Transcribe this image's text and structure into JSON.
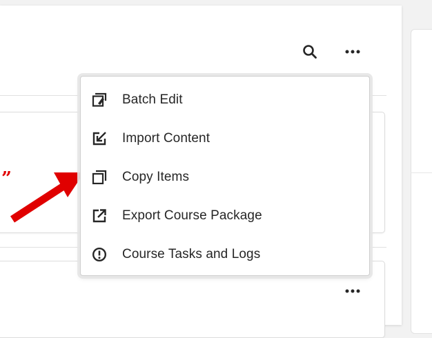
{
  "toolbar": {
    "search_icon": "search-icon",
    "more_icon": "more-horizontal-icon"
  },
  "menu": {
    "items": [
      {
        "label": "Batch Edit",
        "icon": "batch-edit-icon"
      },
      {
        "label": "Import Content",
        "icon": "import-content-icon"
      },
      {
        "label": "Copy Items",
        "icon": "copy-items-icon"
      },
      {
        "label": "Export Course Package",
        "icon": "export-icon"
      },
      {
        "label": "Course Tasks and Logs",
        "icon": "alert-circle-icon"
      }
    ]
  },
  "annotation": {
    "quote_text": "”",
    "color": "#e00000"
  }
}
